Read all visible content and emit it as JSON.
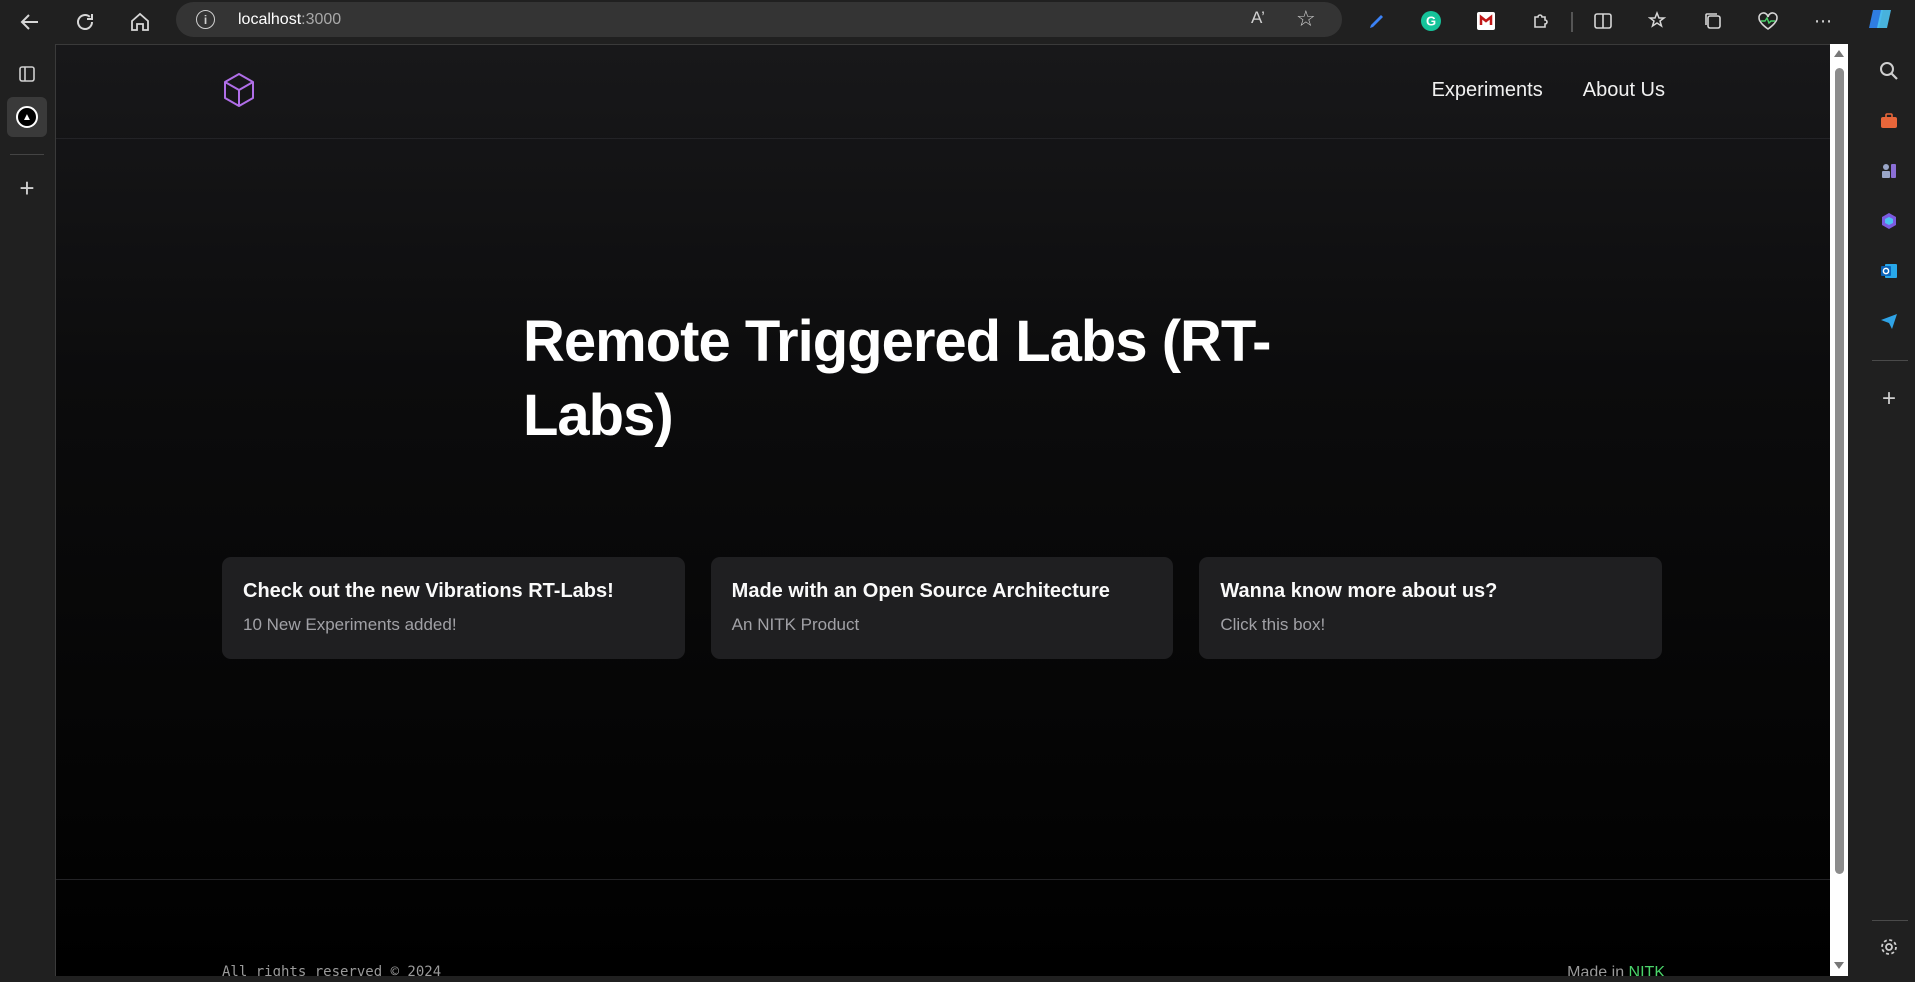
{
  "browser": {
    "url_host": "localhost",
    "url_port": ":3000",
    "read_aloud_label": "A’"
  },
  "site": {
    "nav": {
      "experiments": "Experiments",
      "about": "About Us"
    },
    "hero": {
      "title": "Remote Triggered Labs (RT-Labs)"
    },
    "cards": [
      {
        "title": "Check out the new Vibrations RT-Labs!",
        "subtitle": "10 New Experiments added!"
      },
      {
        "title": "Made with an Open Source Architecture",
        "subtitle": "An NITK Product"
      },
      {
        "title": "Wanna know more about us?",
        "subtitle": "Click this box!"
      }
    ],
    "footer": {
      "copyright": "All rights reserved © 2024",
      "made_prefix": "Made in ",
      "made_org": "NITK"
    }
  },
  "colors": {
    "accent_logo": "#b06ee8",
    "footer_highlight": "#4ad46a",
    "card_bg": "#1f1f21"
  }
}
